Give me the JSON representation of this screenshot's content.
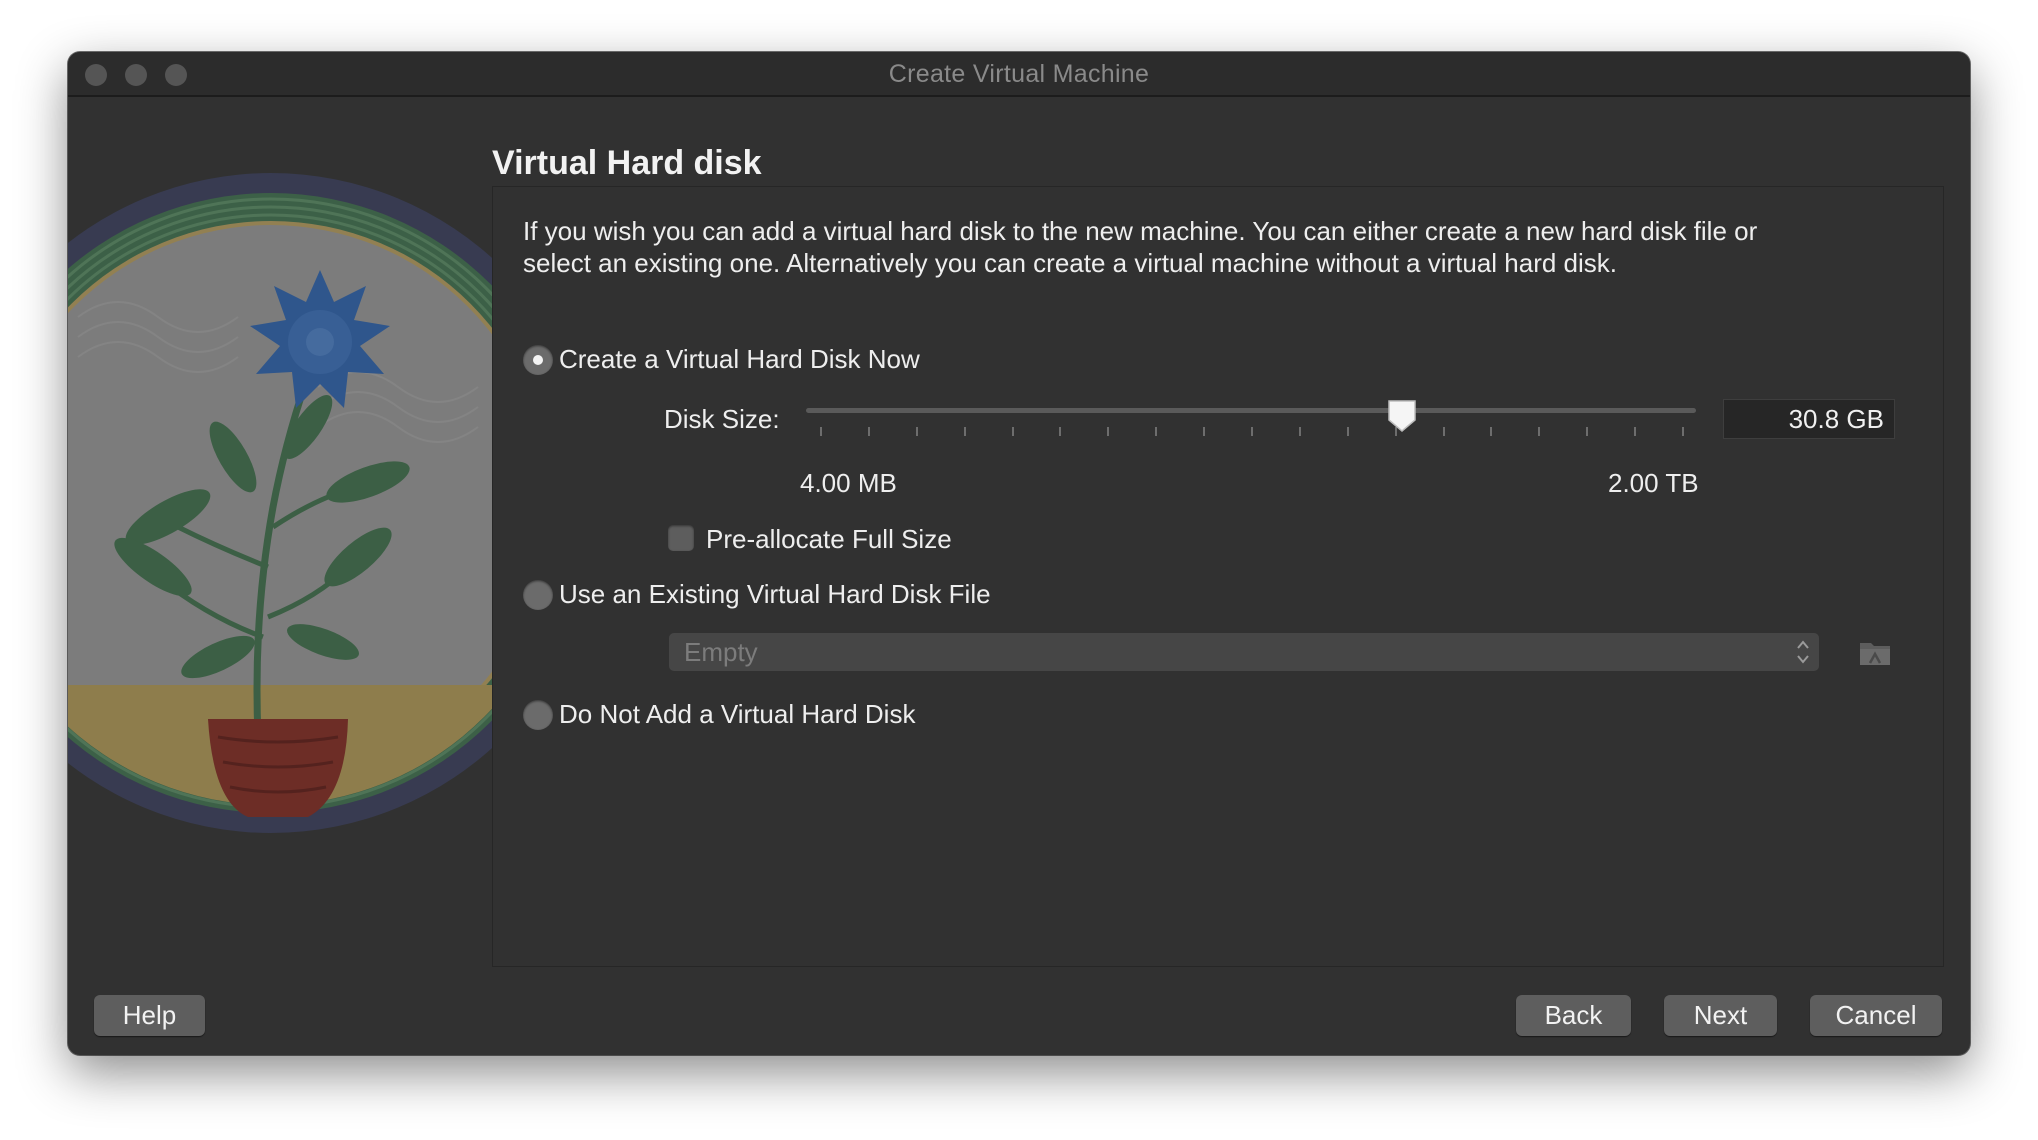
{
  "window": {
    "title": "Create Virtual Machine"
  },
  "page": {
    "heading": "Virtual Hard disk",
    "description": "If you wish you can add a virtual hard disk to the new machine. You can either create a new hard disk file or select an existing one. Alternatively you can create a virtual machine without a virtual hard disk."
  },
  "options": {
    "create_new": {
      "label": "Create a Virtual Hard Disk Now",
      "selected": true
    },
    "use_existing": {
      "label": "Use an Existing Virtual Hard Disk File",
      "selected": false
    },
    "none": {
      "label": "Do Not Add a Virtual Hard Disk",
      "selected": false
    }
  },
  "disk_size": {
    "label": "Disk Size:",
    "value": "30.8 GB",
    "min_label": "4.00 MB",
    "max_label": "2.00 TB",
    "slider_fraction": 0.67
  },
  "preallocate": {
    "label": "Pre-allocate Full Size",
    "checked": false
  },
  "existing_disk": {
    "selected_value": "Empty",
    "folder_icon": "folder-icon"
  },
  "buttons": {
    "help": "Help",
    "back": "Back",
    "next": "Next",
    "cancel": "Cancel"
  },
  "colors": {
    "window_bg": "#313131",
    "text": "#eeeeee",
    "button_bg": "#5e5e5e"
  }
}
